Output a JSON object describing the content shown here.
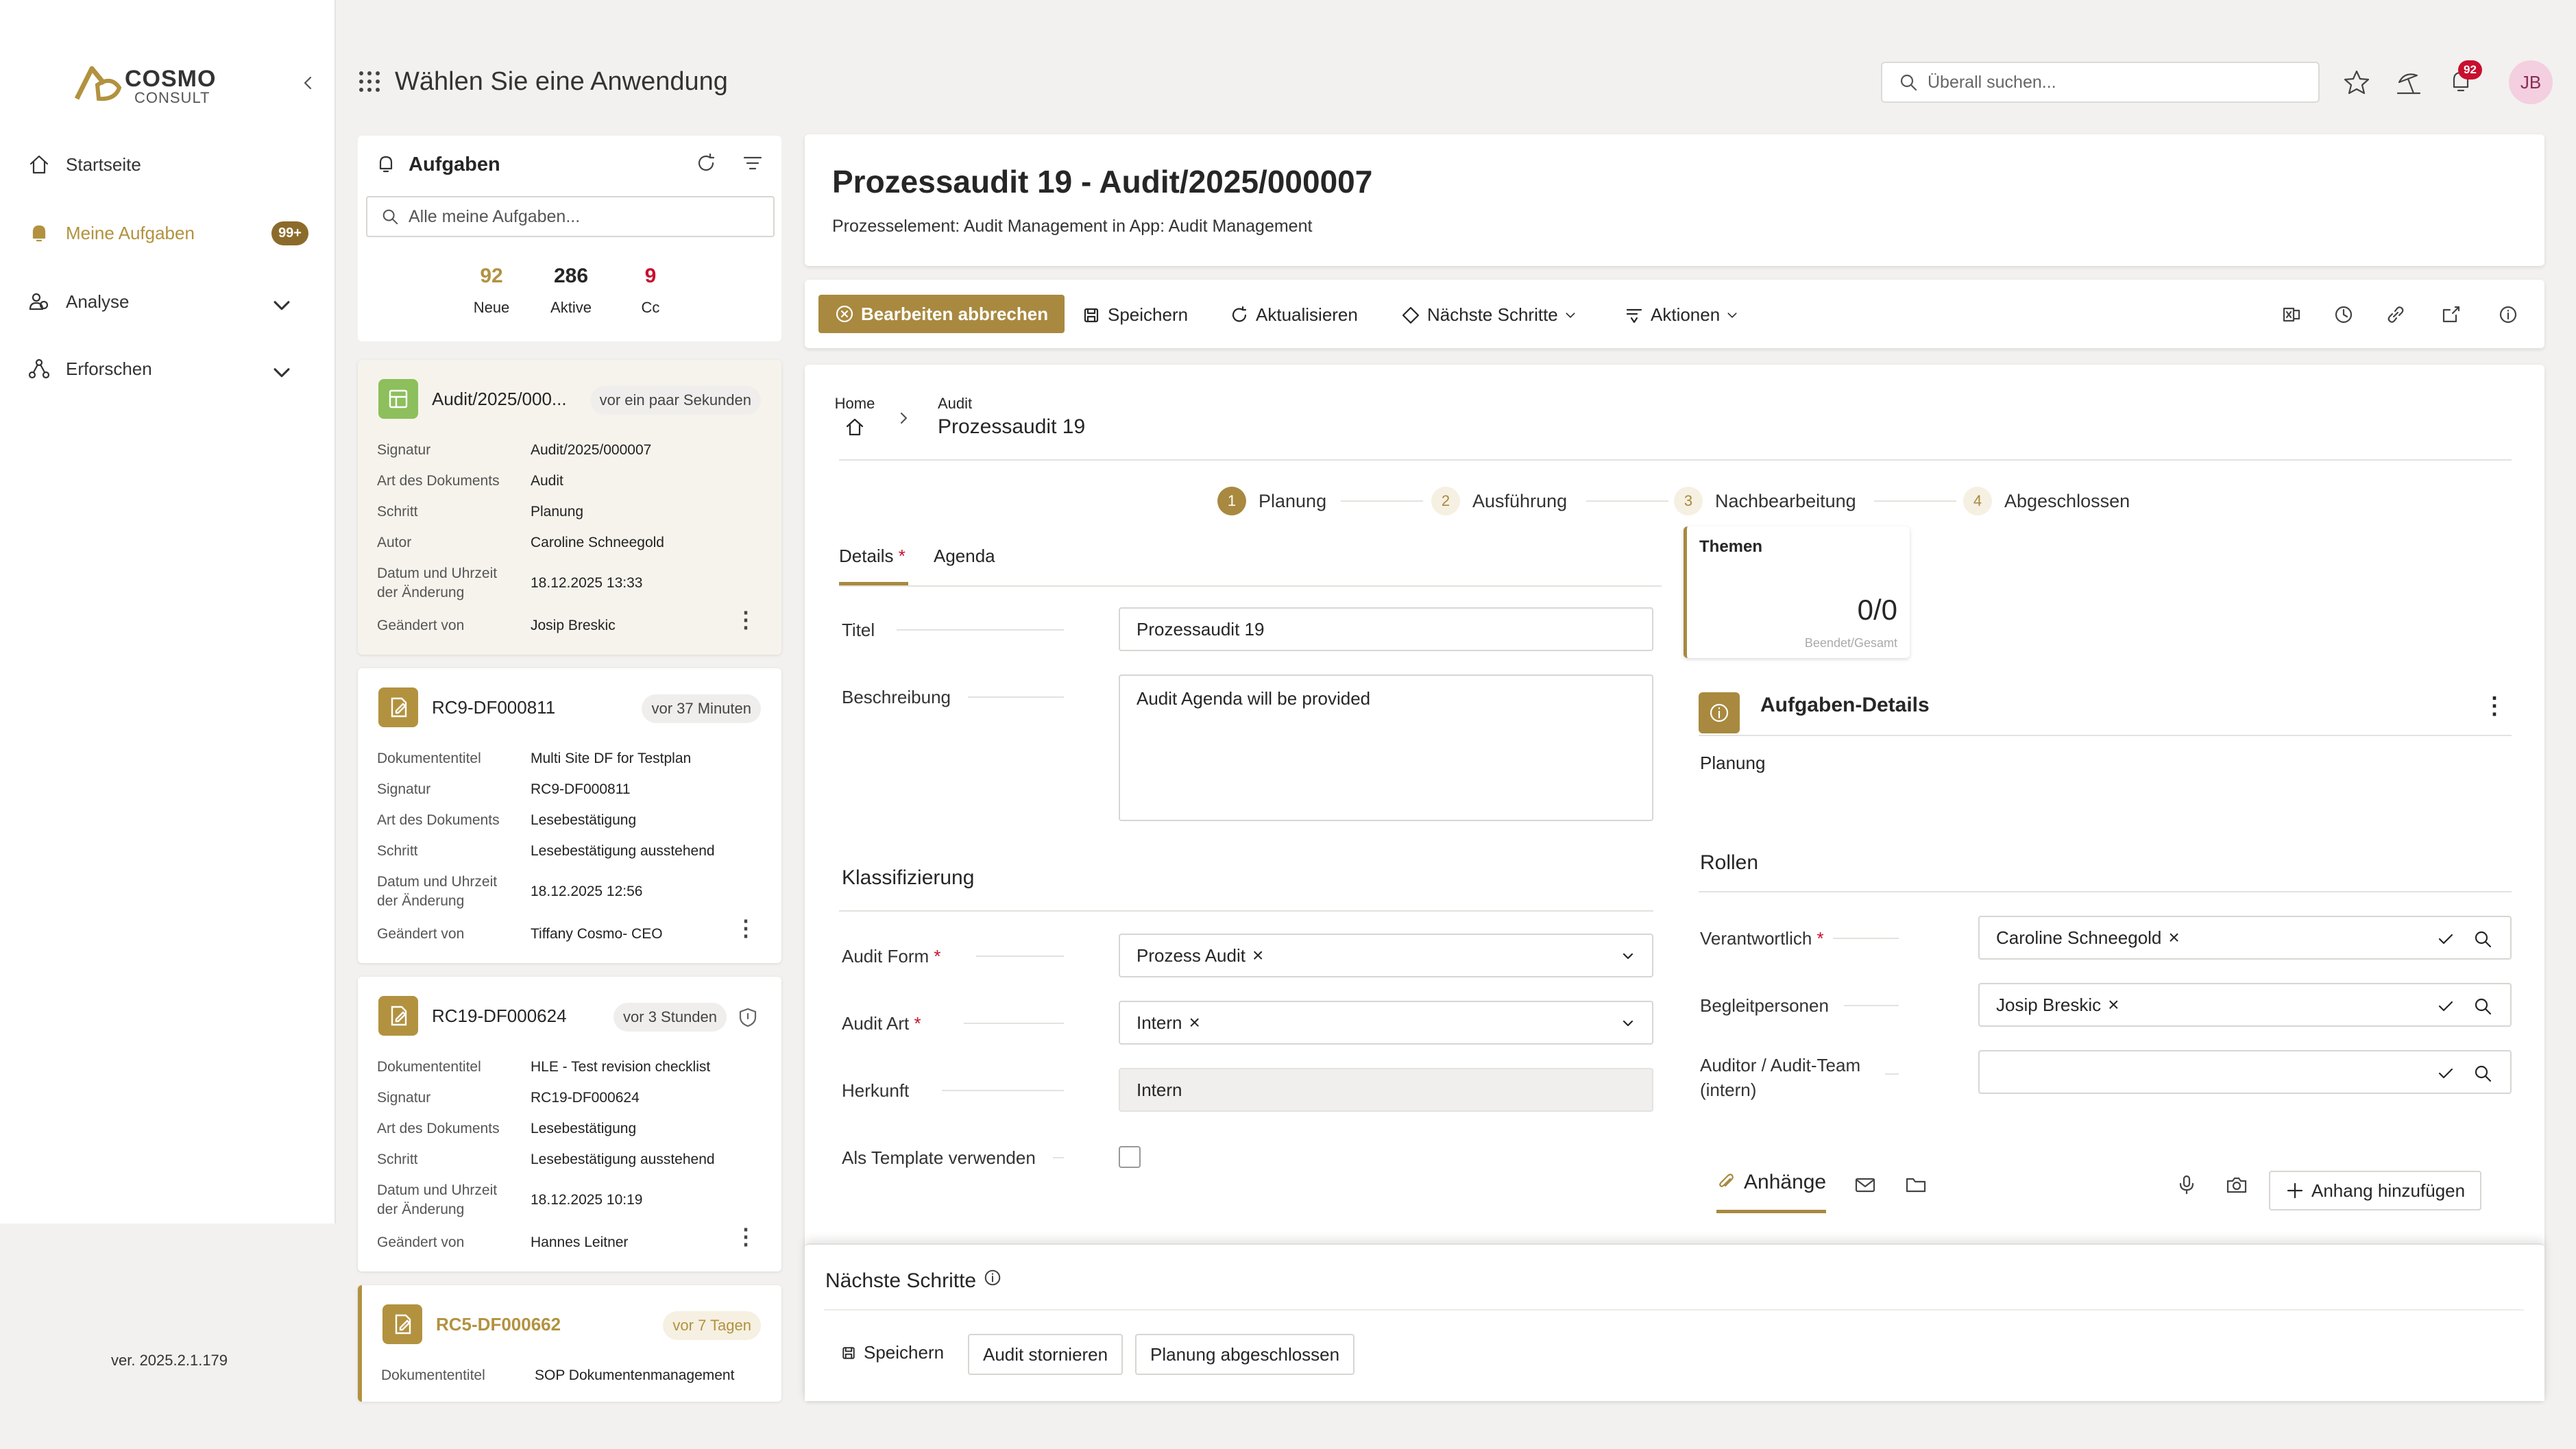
{
  "sidebar": {
    "logo_brand": "COSMO",
    "logo_sub": "CONSULT",
    "items": [
      {
        "label": "Startseite"
      },
      {
        "label": "Meine Aufgaben",
        "badge": "99+"
      },
      {
        "label": "Analyse"
      },
      {
        "label": "Erforschen"
      }
    ],
    "version": "ver. 2025.2.1.179"
  },
  "topbar": {
    "app_title": "Wählen Sie eine Anwendung",
    "search_placeholder": "Überall suchen...",
    "notification_count": "92",
    "avatar": "JB"
  },
  "tasks": {
    "title": "Aufgaben",
    "search_placeholder": "Alle meine Aufgaben...",
    "stats": [
      {
        "value": "92",
        "label": "Neue"
      },
      {
        "value": "286",
        "label": "Aktive"
      },
      {
        "value": "9",
        "label": "Cc"
      }
    ],
    "cards": [
      {
        "title": "Audit/2025/000...",
        "time": "vor ein paar Sekunden",
        "rows": [
          [
            "Signatur",
            "Audit/2025/000007"
          ],
          [
            "Art des Dokuments",
            "Audit"
          ],
          [
            "Schritt",
            "Planung"
          ],
          [
            "Autor",
            "Caroline Schneegold"
          ],
          [
            "Datum und Uhrzeit der Änderung",
            "18.12.2025 13:33"
          ],
          [
            "Geändert von",
            "Josip Breskic"
          ]
        ]
      },
      {
        "title": "RC9-DF000811",
        "time": "vor 37 Minuten",
        "rows": [
          [
            "Dokumententitel",
            "Multi Site DF for Testplan"
          ],
          [
            "Signatur",
            "RC9-DF000811"
          ],
          [
            "Art des Dokuments",
            "Lesebestätigung"
          ],
          [
            "Schritt",
            "Lesebestätigung ausstehend"
          ],
          [
            "Datum und Uhrzeit der Änderung",
            "18.12.2025 12:56"
          ],
          [
            "Geändert von",
            "Tiffany Cosmo- CEO"
          ]
        ]
      },
      {
        "title": "RC19-DF000624",
        "time": "vor 3 Stunden",
        "rows": [
          [
            "Dokumententitel",
            "HLE - Test revision checklist"
          ],
          [
            "Signatur",
            "RC19-DF000624"
          ],
          [
            "Art des Dokuments",
            "Lesebestätigung"
          ],
          [
            "Schritt",
            "Lesebestätigung ausstehend"
          ],
          [
            "Datum und Uhrzeit der Änderung",
            "18.12.2025 10:19"
          ],
          [
            "Geändert von",
            "Hannes Leitner"
          ]
        ]
      },
      {
        "title": "RC5-DF000662",
        "time": "vor 7 Tagen",
        "rows": [
          [
            "Dokumententitel",
            "SOP Dokumentenmanagement"
          ]
        ]
      }
    ]
  },
  "header": {
    "title": "Prozessaudit 19 - Audit/2025/000007",
    "subtitle": "Prozesselement: Audit Management in App: Audit Management"
  },
  "toolbar": {
    "cancel_edit": "Bearbeiten abbrechen",
    "save": "Speichern",
    "refresh": "Aktualisieren",
    "next_steps": "Nächste Schritte",
    "actions": "Aktionen"
  },
  "breadcrumb": {
    "home": "Home",
    "parent": "Audit",
    "current": "Prozessaudit 19"
  },
  "steps": [
    {
      "num": "1",
      "label": "Planung"
    },
    {
      "num": "2",
      "label": "Ausführung"
    },
    {
      "num": "3",
      "label": "Nachbearbeitung"
    },
    {
      "num": "4",
      "label": "Abgeschlossen"
    }
  ],
  "tabs": {
    "details": "Details",
    "required": "*",
    "agenda": "Agenda"
  },
  "form": {
    "titel_label": "Titel",
    "titel_value": "Prozessaudit 19",
    "beschreibung_label": "Beschreibung",
    "beschreibung_value": "Audit Agenda will be provided",
    "klassifizierung": "Klassifizierung",
    "audit_form_label": "Audit Form",
    "audit_form_value": "Prozess Audit",
    "audit_art_label": "Audit Art",
    "audit_art_value": "Intern",
    "herkunft_label": "Herkunft",
    "herkunft_value": "Intern",
    "template_label": "Als Template verwenden"
  },
  "themen": {
    "title": "Themen",
    "value": "0/0",
    "caption": "Beendet/Gesamt"
  },
  "aufgaben_details": {
    "title": "Aufgaben-Details",
    "step": "Planung"
  },
  "rollen": {
    "title": "Rollen",
    "verantwortlich_label": "Verantwortlich",
    "verantwortlich_value": "Caroline Schneegold",
    "begleit_label": "Begleitpersonen",
    "begleit_value": "Josip Breskic",
    "auditor_label": "Auditor / Audit-Team (intern)"
  },
  "anhaenge": {
    "title": "Anhänge",
    "add": "Anhang hinzufügen"
  },
  "next_panel": {
    "title": "Nächste Schritte",
    "save": "Speichern",
    "cancel_audit": "Audit stornieren",
    "planning_done": "Planung abgeschlossen"
  },
  "colors": {
    "accent": "#b2923f",
    "accent_dark": "#8c6b2a",
    "notification": "#c8102e"
  }
}
